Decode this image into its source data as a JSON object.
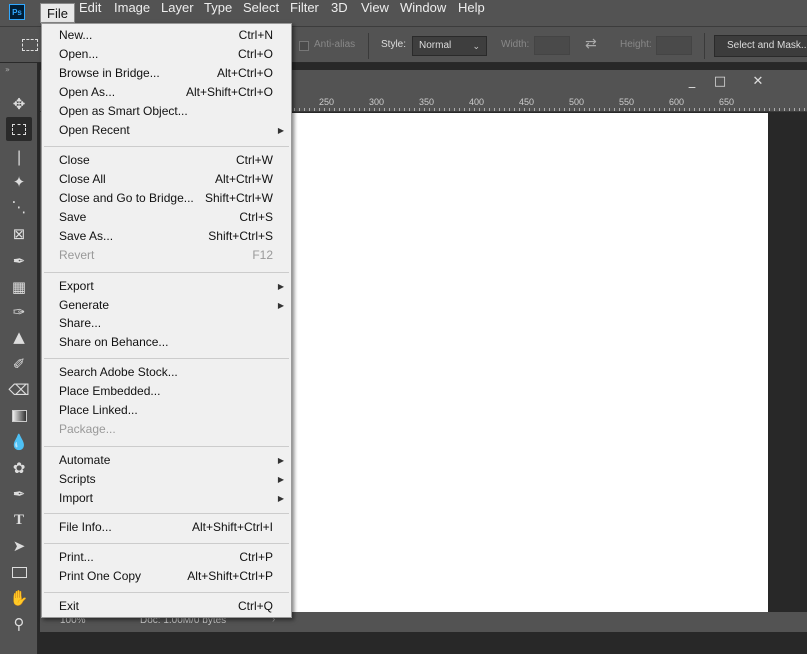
{
  "app": {
    "logo": "Ps",
    "menubar": [
      "File",
      "Edit",
      "Image",
      "Layer",
      "Type",
      "Select",
      "Filter",
      "3D",
      "View",
      "Window",
      "Help"
    ],
    "active_menu": "File"
  },
  "options_bar": {
    "anti_alias_label": "Anti-alias",
    "style_label": "Style:",
    "style_value": "Normal",
    "width_label": "Width:",
    "height_label": "Height:",
    "select_mask_button": "Select and Mask..."
  },
  "toolbar": {
    "tools": [
      "move-icon",
      "rectangular-marquee-icon",
      "lasso-icon",
      "magic-wand-icon",
      "crop-icon",
      "frame-icon",
      "eyedropper-icon",
      "healing-brush-icon",
      "brush-icon",
      "clone-stamp-icon",
      "history-brush-icon",
      "eraser-icon",
      "gradient-icon",
      "blur-icon",
      "sponge-icon",
      "pen-icon",
      "type-icon",
      "path-selection-icon",
      "rectangle-icon",
      "hand-icon",
      "zoom-icon"
    ]
  },
  "document": {
    "ruler_labels": [
      "250",
      "300",
      "350",
      "400",
      "450",
      "500",
      "550",
      "600",
      "650"
    ],
    "zoom": "100%",
    "doc_info": "Doc: 1.00M/0 bytes",
    "minimize": "_",
    "restore": "□",
    "close": "✕"
  },
  "file_menu": {
    "items": [
      {
        "label": "New...",
        "shortcut": "Ctrl+N"
      },
      {
        "label": "Open...",
        "shortcut": "Ctrl+O"
      },
      {
        "label": "Browse in Bridge...",
        "shortcut": "Alt+Ctrl+O"
      },
      {
        "label": "Open As...",
        "shortcut": "Alt+Shift+Ctrl+O"
      },
      {
        "label": "Open as Smart Object...",
        "shortcut": ""
      },
      {
        "label": "Open Recent",
        "shortcut": "",
        "submenu": true
      },
      {
        "label": "Close",
        "shortcut": "Ctrl+W"
      },
      {
        "label": "Close All",
        "shortcut": "Alt+Ctrl+W"
      },
      {
        "label": "Close and Go to Bridge...",
        "shortcut": "Shift+Ctrl+W"
      },
      {
        "label": "Save",
        "shortcut": "Ctrl+S"
      },
      {
        "label": "Save As...",
        "shortcut": "Shift+Ctrl+S"
      },
      {
        "label": "Revert",
        "shortcut": "F12",
        "disabled": true
      },
      {
        "label": "Export",
        "shortcut": "",
        "submenu": true
      },
      {
        "label": "Generate",
        "shortcut": "",
        "submenu": true
      },
      {
        "label": "Share...",
        "shortcut": ""
      },
      {
        "label": "Share on Behance...",
        "shortcut": ""
      },
      {
        "label": "Search Adobe Stock...",
        "shortcut": ""
      },
      {
        "label": "Place Embedded...",
        "shortcut": ""
      },
      {
        "label": "Place Linked...",
        "shortcut": ""
      },
      {
        "label": "Package...",
        "shortcut": "",
        "disabled": true
      },
      {
        "label": "Automate",
        "shortcut": "",
        "submenu": true
      },
      {
        "label": "Scripts",
        "shortcut": "",
        "submenu": true
      },
      {
        "label": "Import",
        "shortcut": "",
        "submenu": true
      },
      {
        "label": "File Info...",
        "shortcut": "Alt+Shift+Ctrl+I"
      },
      {
        "label": "Print...",
        "shortcut": "Ctrl+P"
      },
      {
        "label": "Print One Copy",
        "shortcut": "Alt+Shift+Ctrl+P"
      },
      {
        "label": "Exit",
        "shortcut": "Ctrl+Q"
      }
    ]
  }
}
